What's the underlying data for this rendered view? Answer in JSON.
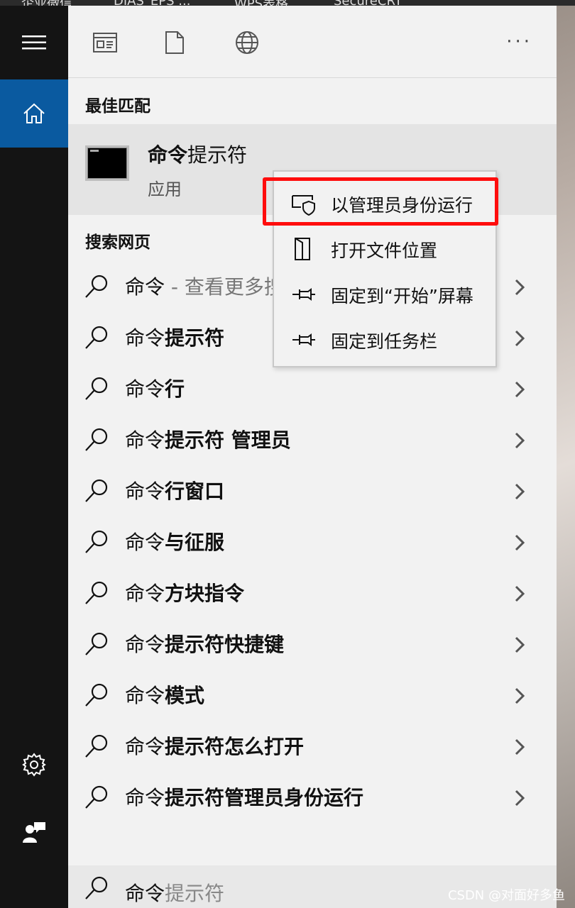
{
  "taskbar": {
    "titles": [
      "企业微信",
      "DIAS_EPS ...",
      "WPS表格",
      "SecureCRT"
    ]
  },
  "rail": {
    "menu_icon": "hamburger-menu-icon",
    "home_icon": "home-icon",
    "settings_icon": "gear-icon",
    "feedback_icon": "feedback-icon",
    "active_color": "#0a5aa0"
  },
  "filters": {
    "icons": [
      "documents-icon",
      "file-icon",
      "web-globe-icon"
    ],
    "more_label": "···"
  },
  "best_match": {
    "heading": "最佳匹配",
    "name_bold": "命令",
    "name_rest": "提示符",
    "type": "应用"
  },
  "web_search": {
    "heading": "搜索网页",
    "items": [
      {
        "prefix": "命令",
        "bold": "",
        "rest": " - 查看更多搜"
      },
      {
        "prefix": "命令",
        "bold": "提示符",
        "rest": ""
      },
      {
        "prefix": "命令",
        "bold": "行",
        "rest": ""
      },
      {
        "prefix": "命令",
        "bold": "提示符 管理员",
        "rest": ""
      },
      {
        "prefix": "命令",
        "bold": "行窗口",
        "rest": ""
      },
      {
        "prefix": "命令",
        "bold": "与征服",
        "rest": ""
      },
      {
        "prefix": "命令",
        "bold": "方块指令",
        "rest": ""
      },
      {
        "prefix": "命令",
        "bold": "提示符快捷键",
        "rest": ""
      },
      {
        "prefix": "命令",
        "bold": "模式",
        "rest": ""
      },
      {
        "prefix": "命令",
        "bold": "提示符怎么打开",
        "rest": ""
      },
      {
        "prefix": "命令",
        "bold": "提示符管理员身份运行",
        "rest": ""
      }
    ]
  },
  "context_menu": {
    "items": [
      {
        "label": "以管理员身份运行",
        "icon": "shield-icon"
      },
      {
        "label": "打开文件位置",
        "icon": "folder-open-icon"
      },
      {
        "label": "固定到“开始”屏幕",
        "icon": "pin-icon"
      },
      {
        "label": "固定到任务栏",
        "icon": "pin-icon"
      }
    ],
    "highlight_color": "#ff0d0d"
  },
  "search_box": {
    "typed": "命令",
    "suggestion": "提示符"
  },
  "watermark": "CSDN @对面好多鱼"
}
